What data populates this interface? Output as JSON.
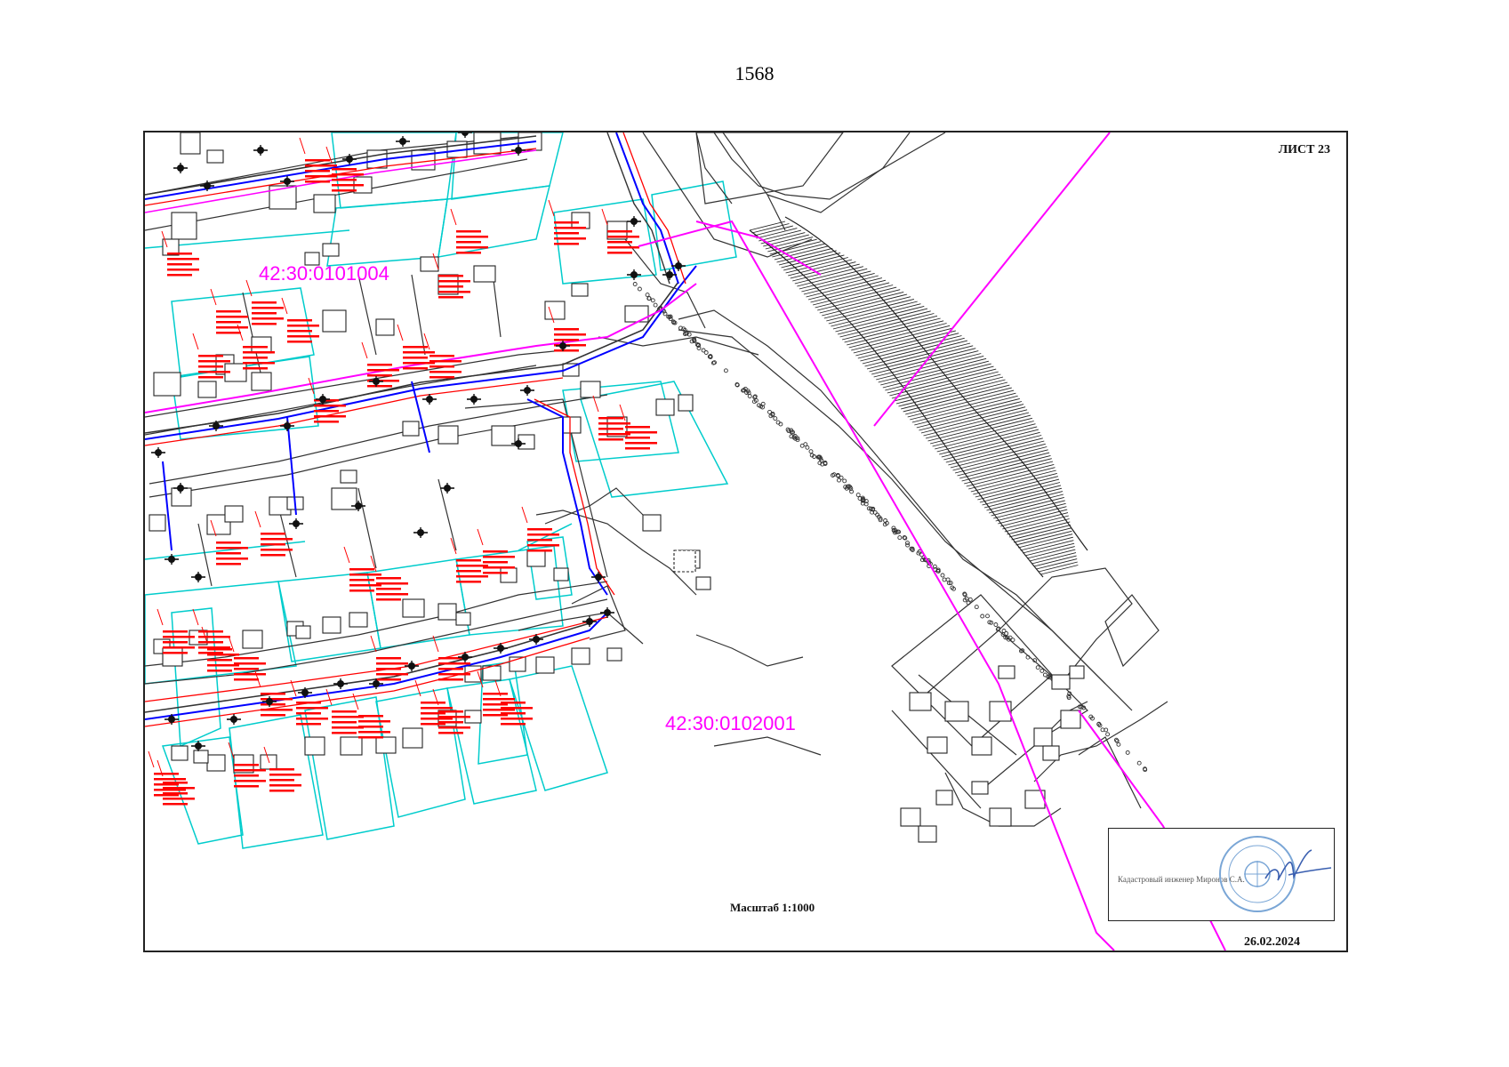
{
  "page_number": "1568",
  "sheet_label": "ЛИСТ 23",
  "parcels": [
    {
      "id": "42:30:0101004"
    },
    {
      "id": "42:30:0102001"
    }
  ],
  "scale": "Масштаб 1:1000",
  "date": "26.02.2024",
  "stamp": {
    "caption": "Кадастровый инженер   Миронов С.А."
  },
  "colors": {
    "parcel_boundary": "#00cccc",
    "quarter_boundary": "#ff00ff",
    "annotation_red": "#ff0000",
    "pipeline_blue": "#0000ff",
    "line_dark": "#333333",
    "seal_blue": "#7aa6d6"
  }
}
